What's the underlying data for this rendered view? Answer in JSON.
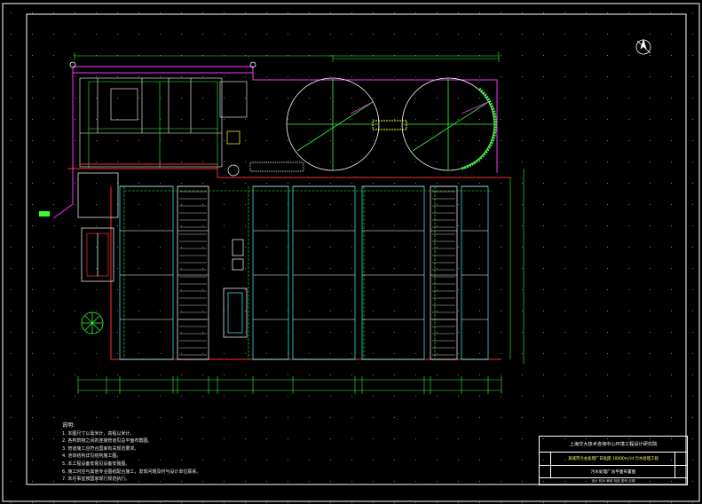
{
  "colors": {
    "background": "#000000",
    "frame": "#ffffff",
    "pipe_red": "#ff3030",
    "pipe_magenta": "#ff30ff",
    "structure_green": "#33ff33",
    "tank_white": "#ffffff",
    "dimension_green": "#33ff33",
    "highlight_yellow": "#ffff33",
    "cyan_lines": "#33ffff"
  },
  "drawing": {
    "north_arrow": "north-arrow-icon",
    "clarifiers": 2,
    "treatment_basins_rows": 4,
    "treatment_basin_columns": 8
  },
  "notes": {
    "title": "说明:",
    "items": [
      "1. 本图尺寸以毫米计，高程以米计。",
      "2. 各构筑物之间的连接管道见总平面布置图。",
      "3. 管道施工应符合国家有关规范要求。",
      "4. 池体结构详见结构施工图。",
      "5. 本工程设备安装见设备安装图。",
      "6. 施工时应与其他专业图纸配合施工，发现问题及时与设计单位联系。",
      "7. 未尽事宜按国家现行规范执行。"
    ]
  },
  "title_block": {
    "institute": "上海交大技术咨询中心环境工程设计研究院",
    "project": "某城市污水处理厂日处理 10000m³/d 污水处理工程",
    "drawing_title": "污水处理厂总平面布置图",
    "footer": "设计  校对  审核  批准  图号  日期"
  }
}
